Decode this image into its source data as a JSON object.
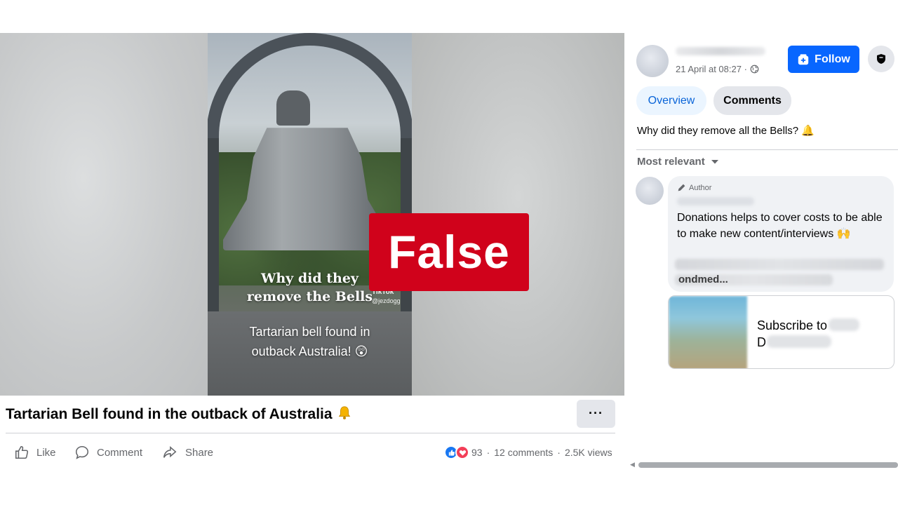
{
  "video": {
    "overlay_caption_line1": "Why did they",
    "overlay_caption_line2": "remove the Bells",
    "tiktok_brand": "TikTok",
    "tiktok_handle": "@jezdogg",
    "subtitle_line1": "Tartarian bell found in",
    "subtitle_line2": "outback Australia! 😲",
    "fact_check_label": "False",
    "fact_check_color": "#d0021b",
    "mute_icon": "speaker-muted-icon"
  },
  "post": {
    "title": "Tartarian Bell found in the outback of Australia",
    "title_emoji": "bell-icon",
    "more_label": "···",
    "actions": {
      "like": "Like",
      "comment": "Comment",
      "share": "Share"
    },
    "stats": {
      "reactions": "93",
      "comments": "12 comments",
      "views": "2.5K views",
      "separator": "·"
    }
  },
  "sidebar": {
    "timestamp": "21 April at 08:27 ·",
    "follow_label": "Follow",
    "tabs": [
      {
        "label": "Overview",
        "active": true
      },
      {
        "label": "Comments",
        "active": false
      }
    ],
    "post_text": "Why did they remove all the Bells? 🔔",
    "sort_label": "Most relevant",
    "comment": {
      "badge": "Author",
      "text": "Donations helps to cover costs to be able to make new content/interviews 🙌",
      "link_fragment": "ondmed..."
    },
    "link_preview": {
      "title_line1": "Subscribe to",
      "title_line2": "D"
    }
  },
  "colors": {
    "accent": "#0866ff",
    "text_secondary": "#65676b",
    "bubble_bg": "#f0f2f5"
  }
}
